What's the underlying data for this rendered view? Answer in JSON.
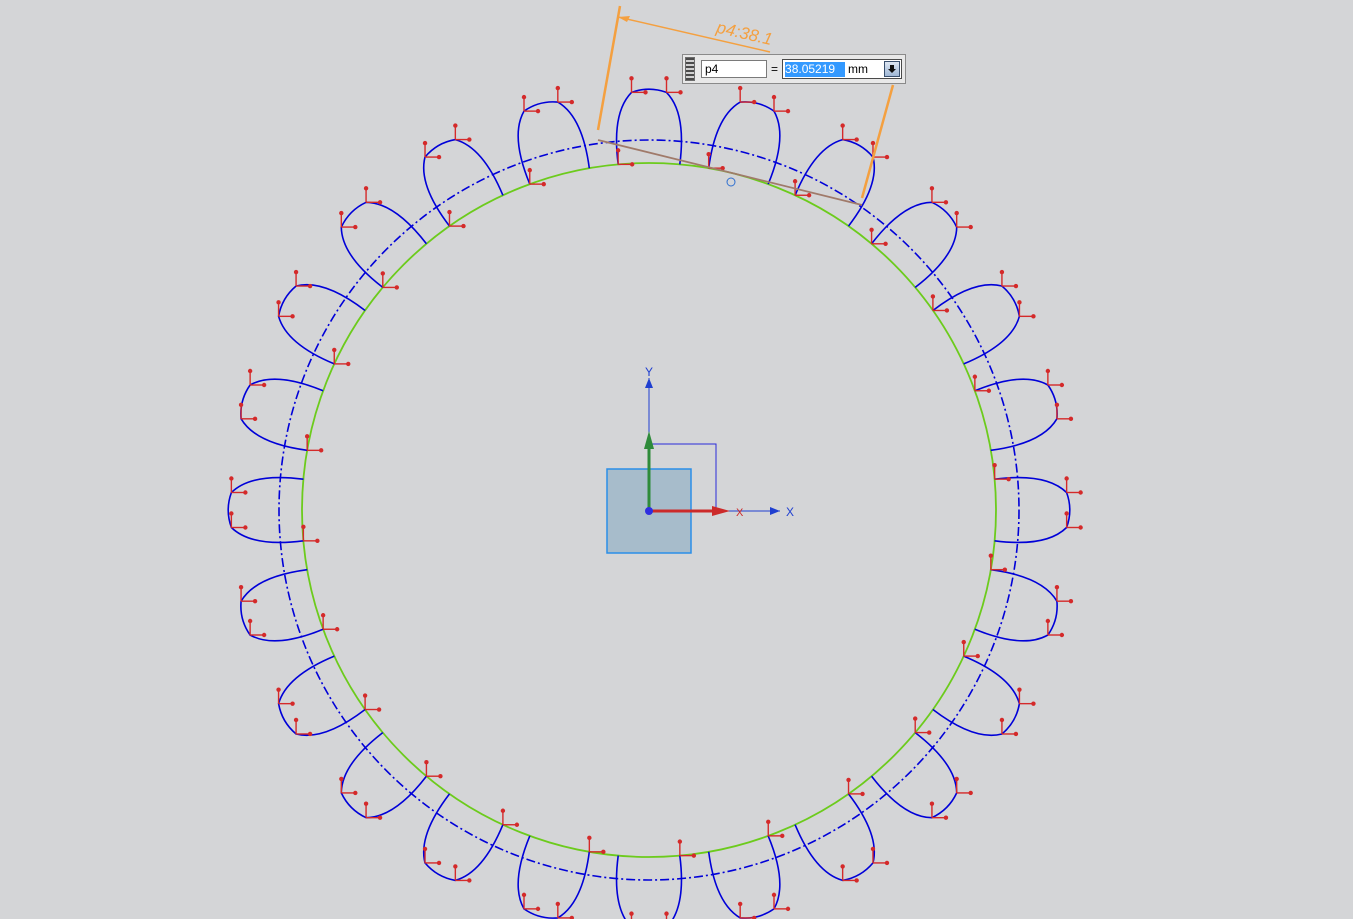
{
  "dimension": {
    "annotation": "p4:38.1",
    "name": "p4",
    "equals": "=",
    "value": "38.05219",
    "unit": "mm"
  },
  "axes": {
    "x_label": "X",
    "y_label": "Y",
    "x_label_small": "X"
  },
  "gear": {
    "teeth": 24
  },
  "icons": {
    "grip": "grip-icon",
    "dropdown": "chevron-down-icon"
  },
  "colors": {
    "background": "#d4d5d7",
    "tooth_profile": "#0000d8",
    "root_circle": "#6ccb1c",
    "pitch_circle": "#0000d8",
    "constraint_marker": "#d42a2a",
    "dimension": "#f4a040",
    "selection": "#3399ff"
  }
}
